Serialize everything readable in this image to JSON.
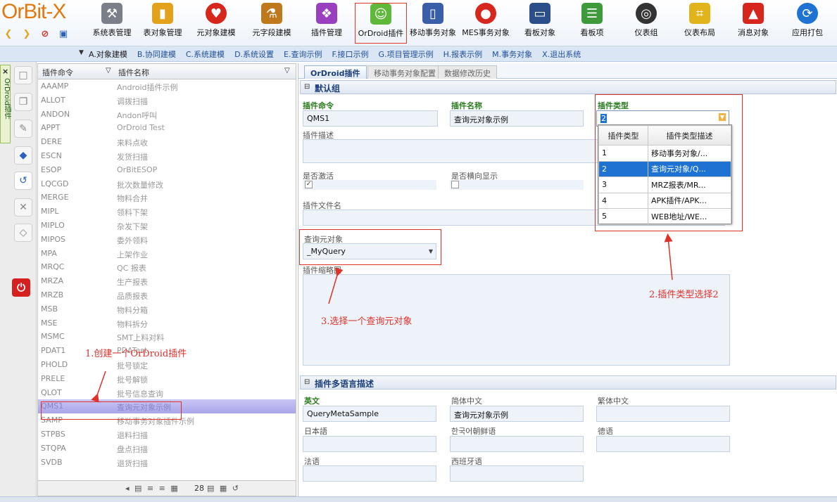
{
  "app": {
    "logo": "OrBit-X"
  },
  "ribbon": {
    "buttons": [
      {
        "label": "系统表管理",
        "icon": "tool-icon"
      },
      {
        "label": "表对象管理",
        "icon": "cylinder-icon"
      },
      {
        "label": "元对象建模",
        "icon": "heart-icon"
      },
      {
        "label": "元字段建模",
        "icon": "flask-icon"
      },
      {
        "label": "插件管理",
        "icon": "puzzle-icon"
      },
      {
        "label": "OrDroid插件",
        "icon": "android-icon"
      },
      {
        "label": "移动事务对象",
        "icon": "mobile-icon"
      },
      {
        "label": "MES事务对象",
        "icon": "pin-icon"
      },
      {
        "label": "看板对象",
        "icon": "monitor-icon"
      },
      {
        "label": "看板项",
        "icon": "list-icon"
      },
      {
        "label": "仪表组",
        "icon": "gauge-icon"
      },
      {
        "label": "仪表布局",
        "icon": "layout-icon"
      },
      {
        "label": "消息对象",
        "icon": "bell-icon"
      },
      {
        "label": "应用打包",
        "icon": "package-icon"
      }
    ]
  },
  "menubar": {
    "items": [
      "A.对象建模",
      "B.协同建模",
      "C.系统建模",
      "D.系统设置",
      "E.查询示例",
      "F.接口示例",
      "G.项目管理示例",
      "H.报表示例",
      "M.事务对象",
      "X.退出系统"
    ]
  },
  "sidetab": {
    "label": "OrDroid插件",
    "close": "×"
  },
  "grid": {
    "columns": [
      "插件命令",
      "插件名称"
    ],
    "rows": [
      [
        "AAAMP",
        "Android插件示例"
      ],
      [
        "ALLOT",
        "调拨扫描"
      ],
      [
        "ANDON",
        "Andon呼叫"
      ],
      [
        "APPT",
        "OrDroid Test"
      ],
      [
        "DERE",
        "来料点收"
      ],
      [
        "ESCN",
        "发货扫描"
      ],
      [
        "ESOP",
        "OrBitESOP"
      ],
      [
        "LQCGD",
        "批次数量修改"
      ],
      [
        "MERGE",
        "物料合并"
      ],
      [
        "MIPL",
        "领料下架"
      ],
      [
        "MIPLO",
        "杂发下架"
      ],
      [
        "MIPOS",
        "委外领料"
      ],
      [
        "MPA",
        "上架作业"
      ],
      [
        "MRQC",
        "QC 报表"
      ],
      [
        "MRZA",
        "生产报表"
      ],
      [
        "MRZB",
        "品质报表"
      ],
      [
        "MSB",
        "物料分箱"
      ],
      [
        "MSE",
        "物料拆分"
      ],
      [
        "MSMC",
        "SMT上料对料"
      ],
      [
        "PDAT1",
        "PDATest"
      ],
      [
        "PHOLD",
        "批号锁定"
      ],
      [
        "PRELE",
        "批号解锁"
      ],
      [
        "QLOT",
        "批号信息查询"
      ],
      [
        "QMS1",
        "查询元对象示例"
      ],
      [
        "SAMP",
        "移动事务对象插件示例"
      ],
      [
        "STPBS",
        "退料扫描"
      ],
      [
        "STQPA",
        "盘点扫描"
      ],
      [
        "SVDB",
        "退货扫描"
      ]
    ],
    "selected_index": 23,
    "footer": {
      "count": "28"
    }
  },
  "form": {
    "tabs": [
      "OrDroid插件",
      "移动事务对象配置",
      "数据修改历史"
    ],
    "group_default": "默认组",
    "fields": {
      "command_label": "插件命令",
      "command_value": "QMS1",
      "name_label": "插件名称",
      "name_value": "查询元对象示例",
      "type_label": "插件类型",
      "type_value": "2",
      "desc_label": "插件描述",
      "active_label": "是否激活",
      "active_checked": true,
      "landscape_label": "是否横向显示",
      "landscape_checked": false,
      "file_label": "插件文件名",
      "query_label": "查询元对象",
      "query_value": "_MyQuery",
      "thumb_label": "插件缩略图"
    },
    "type_dropdown": {
      "columns": [
        "插件类型",
        "插件类型描述"
      ],
      "rows": [
        [
          "1",
          "移动事务对象/..."
        ],
        [
          "2",
          "查询元对象/Q..."
        ],
        [
          "3",
          "MRZ报表/MR..."
        ],
        [
          "4",
          "APK插件/APK..."
        ],
        [
          "5",
          "WEB地址/WE..."
        ]
      ],
      "selected_index": 1
    },
    "group_lang": "插件多语言描述",
    "lang": {
      "en_label": "英文",
      "en_value": "QueryMetaSample",
      "zh_label": "简体中文",
      "zh_value": "查询元对象示例",
      "tw_label": "繁体中文",
      "ja_label": "日本語",
      "ko_label": "한국어朝鲜语",
      "de_label": "德语",
      "fr_label": "法语",
      "es_label": "西班牙语"
    }
  },
  "annotations": {
    "step1": "1.创建一个OrDroid插件",
    "step2": "2.插件类型选择2",
    "step3": "3.选择一个查询元对象"
  },
  "colors": {
    "accent": "#1e73d2",
    "annotation": "#e0302a",
    "selected_row": "#b3afed"
  }
}
